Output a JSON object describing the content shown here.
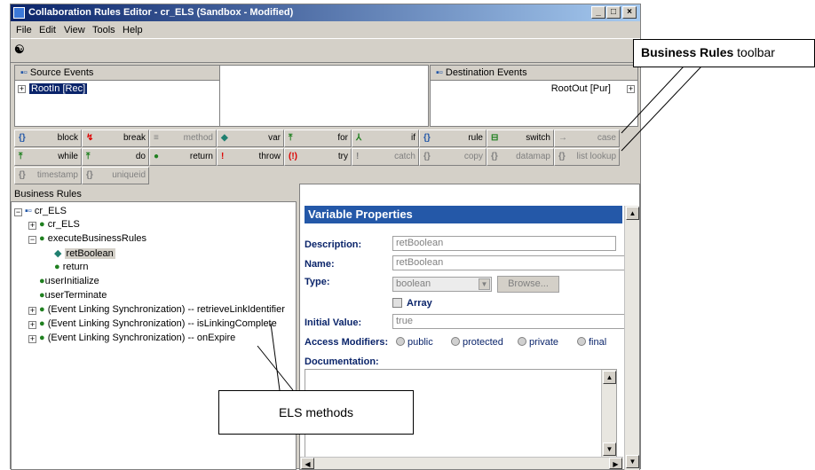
{
  "window": {
    "title": "Collaboration Rules Editor - cr_ELS (Sandbox - Modified)",
    "controls": [
      "_",
      "□",
      "×"
    ]
  },
  "menu": [
    "File",
    "Edit",
    "View",
    "Tools",
    "Help"
  ],
  "toolbar_icon": "binoculars-icon",
  "events": {
    "source_label": "Source Events",
    "source_item": "RootIn [Rec]",
    "dest_label": "Destination Events",
    "dest_item": "RootOut [Pur]"
  },
  "rules_toolbar": {
    "row1": [
      {
        "icon": "{}",
        "label": "block"
      },
      {
        "icon": "↯",
        "label": "break"
      },
      {
        "icon": "≡",
        "label": "method"
      },
      {
        "icon": "◆",
        "label": "var"
      },
      {
        "icon": "⤒",
        "label": "for"
      },
      {
        "icon": "⅄",
        "label": "if"
      },
      {
        "icon": "{}",
        "label": "rule"
      },
      {
        "icon": "⊟",
        "label": "switch"
      },
      {
        "icon": "→",
        "label": "case"
      }
    ],
    "row2": [
      {
        "icon": "⤒",
        "label": "while"
      },
      {
        "icon": "⤒",
        "label": "do"
      },
      {
        "icon": "●",
        "label": "return"
      },
      {
        "icon": "!",
        "label": "throw"
      },
      {
        "icon": "(!)",
        "label": "try"
      },
      {
        "icon": "!",
        "label": "catch"
      },
      {
        "icon": "{}",
        "label": "copy"
      },
      {
        "icon": "{}",
        "label": "datamap"
      },
      {
        "icon": "{}",
        "label": "list lookup"
      }
    ],
    "row3": [
      {
        "icon": "{}",
        "label": "timestamp"
      },
      {
        "icon": "{}",
        "label": "uniqueid"
      }
    ]
  },
  "business_rules": {
    "header": "Business Rules",
    "tree": [
      "cr_ELS",
      "cr_ELS",
      "executeBusinessRules",
      "retBoolean",
      "return",
      "userInitialize",
      "userTerminate",
      "(Event Linking Synchronization) -- retrieveLinkIdentifier",
      "(Event Linking Synchronization) -- isLinkingComplete",
      "(Event Linking Synchronization) -- onExpire"
    ]
  },
  "properties": {
    "header": "Variable Properties",
    "description_label": "Description:",
    "description_value": "retBoolean",
    "name_label": "Name:",
    "name_value": "retBoolean",
    "type_label": "Type:",
    "type_value": "boolean",
    "browse_label": "Browse...",
    "array_label": "Array",
    "initial_label": "Initial Value:",
    "initial_value": "true",
    "access_label": "Access Modifiers:",
    "modifiers": [
      "public",
      "protected",
      "private",
      "final"
    ],
    "documentation_label": "Documentation:"
  },
  "callouts": {
    "toolbar_bold": "Business Rules",
    "toolbar_rest": " toolbar",
    "methods": "ELS methods"
  }
}
